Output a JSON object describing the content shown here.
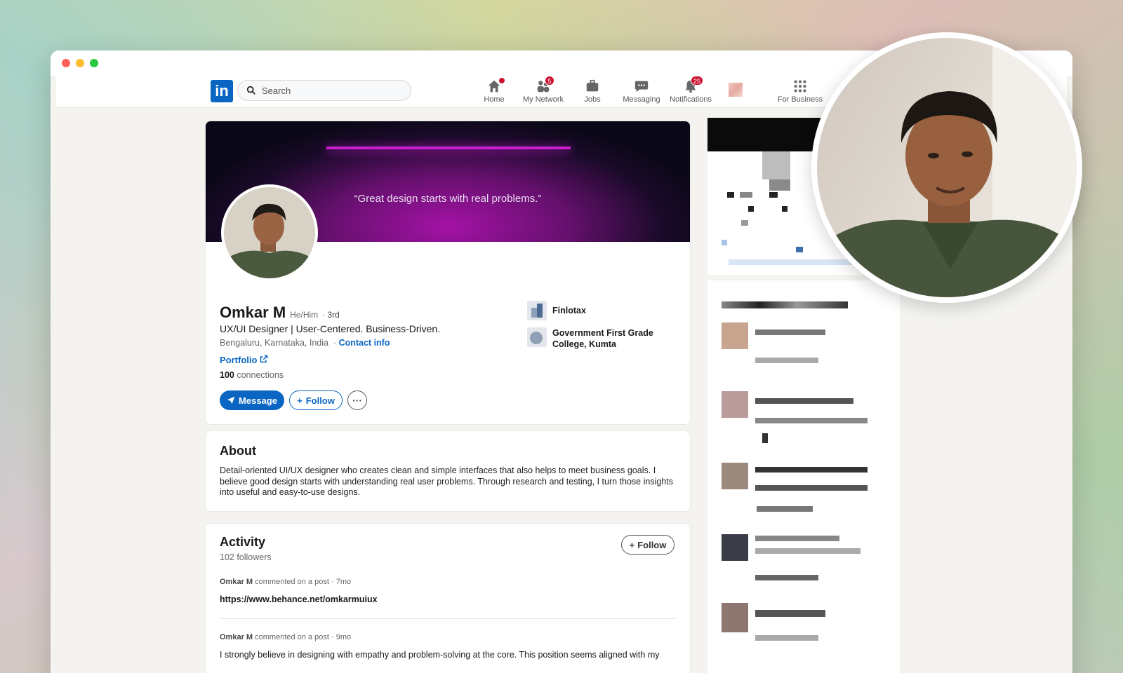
{
  "nav": {
    "search_placeholder": "Search",
    "items": [
      {
        "label": "Home",
        "badge": ""
      },
      {
        "label": "My Network",
        "badge": "5"
      },
      {
        "label": "Jobs",
        "badge": ""
      },
      {
        "label": "Messaging",
        "badge": ""
      },
      {
        "label": "Notifications",
        "badge": "25"
      },
      {
        "label": "For Business",
        "badge": ""
      }
    ]
  },
  "profile": {
    "banner_quote": "“Great design starts with real problems.”",
    "name": "Omkar M",
    "pronouns": "He/Him",
    "degree": "· 3rd",
    "headline": "UX/UI Designer | User-Centered. Business-Driven.",
    "location": "Bengaluru, Karnataka, India",
    "contact_info": "Contact info",
    "portfolio": "Portfolio",
    "connections_count": "100",
    "connections_label": "connections",
    "buttons": {
      "message": "Message",
      "follow": "Follow",
      "more": "···"
    },
    "companies": [
      {
        "name": "Finlotax"
      },
      {
        "name": "Government First Grade College, Kumta"
      }
    ]
  },
  "about": {
    "title": "About",
    "text": "Detail-oriented UI/UX designer who creates clean and simple interfaces that also helps to meet business goals. I believe good design starts with understanding real user problems. Through research and testing, I turn those insights into useful and easy-to-use designs."
  },
  "activity": {
    "title": "Activity",
    "followers": "102 followers",
    "follow": "Follow",
    "posts": [
      {
        "author": "Omkar M",
        "action": "commented on a post",
        "time": "· 7mo",
        "body": "https://www.behance.net/omkarmuiux"
      },
      {
        "author": "Omkar M",
        "action": "commented on a post",
        "time": "· 9mo",
        "body": "I strongly believe in designing with empathy and problem-solving at the core. This position seems aligned with my"
      }
    ]
  },
  "colors": {
    "brand": "#0a66c2",
    "badge": "#cb112d"
  }
}
